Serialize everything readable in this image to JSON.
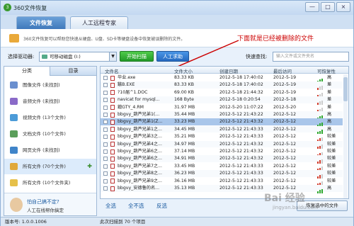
{
  "window": {
    "title": "360文件恢复",
    "min": "—",
    "max": "□",
    "close": "×"
  },
  "tabs": [
    {
      "label": "文件恢复"
    },
    {
      "label": "人工远程专家"
    }
  ],
  "banner": {
    "text": "360文件恢复可以帮助您快速从硬盘、U盘、SD卡等硬盘设备中恢复被误删除的文件。"
  },
  "annotation": "下面就是已经被删除的文件",
  "toolbar": {
    "drive_label": "选择驱动器:",
    "drive_value": "可移动磁盘 (I:)",
    "scan_button": "开始扫描",
    "help_button": "人工求助",
    "search_label": "快速查找:",
    "search_placeholder": "输入文件或文件夹名"
  },
  "sidebar": {
    "tabs": [
      "分类",
      "目录"
    ],
    "items": [
      {
        "label": "图像文件 (未找到)",
        "icon": "image-icon",
        "color": "#6a8fcf"
      },
      {
        "label": "音频文件 (未找到)",
        "icon": "music-icon",
        "color": "#8a6ac8"
      },
      {
        "label": "视频文件 (13个文件)",
        "icon": "video-icon",
        "color": "#4c9bd8"
      },
      {
        "label": "文档文件 (10个文件)",
        "icon": "document-icon",
        "color": "#5a9e5a"
      },
      {
        "label": "网页文件 (未找到)",
        "icon": "web-icon",
        "color": "#3f84c9"
      },
      {
        "label": "所有文件 (70个文件)",
        "icon": "all-files-icon",
        "color": "#e0a83a"
      },
      {
        "label": "所有文件 (10个文件夹)",
        "icon": "folder-icon",
        "color": "#e6c04a"
      }
    ],
    "help_title": "怕自己搞不定?",
    "help_link": "人工在线帮你搞定"
  },
  "table": {
    "headers": [
      "文件名",
      "文件大小",
      "创建日期",
      "最后访问",
      "可恢复性"
    ],
    "rows": [
      {
        "name": "毕业.exe",
        "size": "83.33 KB",
        "created": "2012-5-18 17:40:02",
        "accessed": "2012-5-19",
        "state": "高"
      },
      {
        "name": "鏃В.EXE",
        "size": "83.33 KB",
        "created": "2012-5-18 17:40:02",
        "accessed": "2012-5-19",
        "state": "差"
      },
      {
        "name": "?10届^1.DOC",
        "size": "69.00 KB",
        "created": "2012-5-18 21:44:32",
        "accessed": "2012-5-19",
        "state": "差"
      },
      {
        "name": "navicat for mysql...",
        "size": "168 Byte",
        "created": "2012-5-18 0:20:54",
        "accessed": "2012-5-18",
        "state": "差"
      },
      {
        "name": "鑹GTY_4.RM",
        "size": "31.97 MB",
        "created": "2012-5-20 11:07:22",
        "accessed": "2012-5-20",
        "state": "差"
      },
      {
        "name": "bbgvy_葫芦兄弟1(...",
        "size": "35.44 MB",
        "created": "2012-5-12 21:43:22",
        "accessed": "2012-5-12",
        "state": "高"
      },
      {
        "name": "bbgvy_葫芦兄弟1(Z...",
        "size": "33.23 MB",
        "created": "2012-5-12 21:43:32",
        "accessed": "2012-5-12",
        "state": "高"
      },
      {
        "name": "bbgvy_葫芦兄弟1之...",
        "size": "34.45 MB",
        "created": "2012-5-12 21:43:33",
        "accessed": "2012-5-12",
        "state": "高"
      },
      {
        "name": "bbgvy_葫芦兄弟3之...",
        "size": "35.21 MB",
        "created": "2012-5-12 21:43:33",
        "accessed": "2012-5-12",
        "state": "较差"
      },
      {
        "name": "bbgvy_葫芦兄弟4之...",
        "size": "34.97 MB",
        "created": "2012-5-12 21:43:32",
        "accessed": "2012-5-12",
        "state": "较差"
      },
      {
        "name": "bbgvy_葫芦兄弟6之...",
        "size": "37.14 MB",
        "created": "2012-5-12 21:43:32",
        "accessed": "2012-5-12",
        "state": "较差"
      },
      {
        "name": "bbgvy_葫芦兄弟6之...",
        "size": "34.91 MB",
        "created": "2012-5-12 21:43:32",
        "accessed": "2012-5-12",
        "state": "较差"
      },
      {
        "name": "bbgvy_葫芦兄弟7之...",
        "size": "33.45 MB",
        "created": "2012-5-12 21:43:33",
        "accessed": "2012-5-12",
        "state": "较差"
      },
      {
        "name": "bbgvy_葫芦兄弟8之...",
        "size": "36.23 MB",
        "created": "2012-5-12 21:43:33",
        "accessed": "2012-5-12",
        "state": "较差"
      },
      {
        "name": "bbgvy_葫芦兄弟9之...",
        "size": "36.16 MB",
        "created": "2012-5-12 21:43:33",
        "accessed": "2012-5-12",
        "state": "较差"
      },
      {
        "name": "bbgvy_安德鲁的名...",
        "size": "35.13 MB",
        "created": "2012-5-12 21:43:33",
        "accessed": "2012-5-12",
        "state": "高"
      }
    ],
    "selected_row": 6
  },
  "actions": {
    "select_all": "全选",
    "select_none": "全不选",
    "invert": "反选",
    "recover": "恢复选中的文件"
  },
  "status": {
    "version": "版本号: 1.0.0.1006",
    "found": "此次扫描到 70 个项目"
  },
  "watermark": {
    "text": "Bai 经验",
    "url": "jingyan.baidu.com"
  },
  "colors": {
    "good": "#2fa82f",
    "bad": "#d23c2c",
    "accent": "#3f79bb"
  }
}
